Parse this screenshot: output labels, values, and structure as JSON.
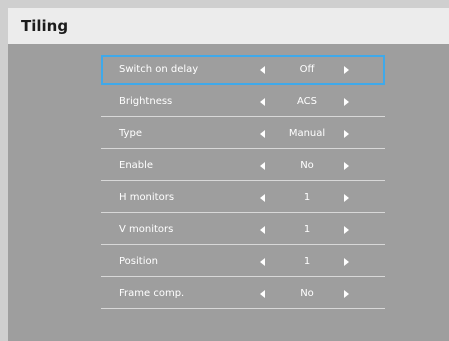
{
  "window": {
    "title": "Tiling"
  },
  "colors": {
    "panel_bg": "#9e9e9e",
    "title_bar_bg": "#ececec",
    "selection_border": "#3fa9ea",
    "text": "#ffffff"
  },
  "menu": {
    "selected_index": 0,
    "items": [
      {
        "label": "Switch on delay",
        "value": "Off"
      },
      {
        "label": "Brightness",
        "value": "ACS"
      },
      {
        "label": "Type",
        "value": "Manual"
      },
      {
        "label": "Enable",
        "value": "No"
      },
      {
        "label": "H monitors",
        "value": "1"
      },
      {
        "label": "V monitors",
        "value": "1"
      },
      {
        "label": "Position",
        "value": "1"
      },
      {
        "label": "Frame comp.",
        "value": "No"
      }
    ]
  }
}
